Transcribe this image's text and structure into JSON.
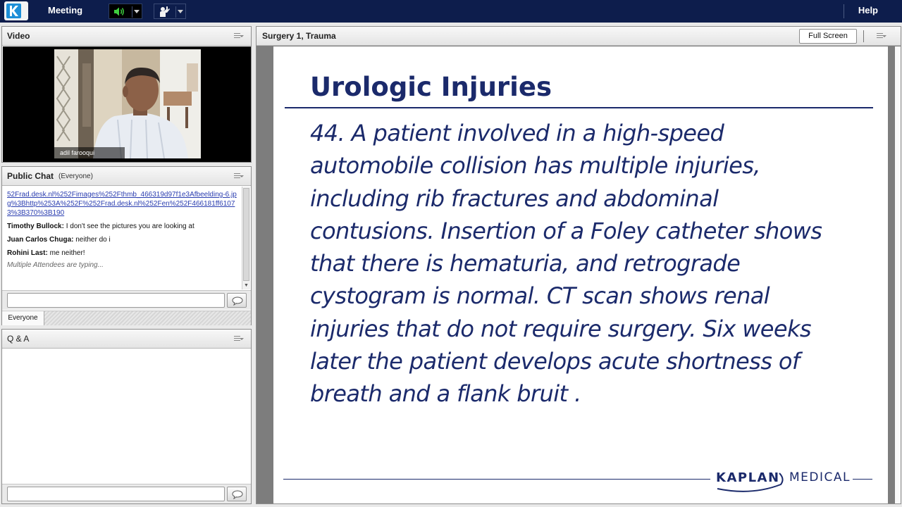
{
  "topbar": {
    "app_logo": "kaplan-k-logo",
    "meeting_label": "Meeting",
    "help_label": "Help",
    "audio_icon": "speaker-icon",
    "hand_icon": "raise-hand-icon"
  },
  "video": {
    "title": "Video",
    "participant_name": "adil farooqui"
  },
  "chat": {
    "title": "Public Chat",
    "scope": "(Everyone)",
    "link_text": "52Frad.desk.nl%252Fimages%252Fthmb_466319d97f1e3Afbeelding-6.jpg%3Bhttp%253A%252F%252Frad.desk.nl%252Fen%252F466181ff61073%3B370%3B190",
    "messages": [
      {
        "sender": "Timothy Bullock:",
        "text": "I don't see the pictures you are looking at"
      },
      {
        "sender": "Juan Carlos Chuga:",
        "text": "neither do i"
      },
      {
        "sender": "Rohini Last:",
        "text": "me neither!"
      }
    ],
    "typing_status": "Multiple Attendees are typing...",
    "input_value": "",
    "tab_everyone": "Everyone"
  },
  "qa": {
    "title": "Q & A",
    "input_value": ""
  },
  "presentation": {
    "title": "Surgery 1, Trauma",
    "fullscreen_label": "Full Screen",
    "slide": {
      "heading": "Urologic Injuries",
      "body_lines": [
        "44. A patient involved in a high-speed",
        "automobile collision has multiple injuries,",
        "including rib fractures and abdominal",
        "contusions. Insertion of a Foley catheter shows",
        "that there is hematuria, and retrograde",
        "cystogram is normal. CT scan shows renal",
        "injuries that do not require surgery. Six weeks",
        "later the patient develops acute shortness of",
        "breath and a flank bruit ."
      ],
      "brand_kaplan": "KAPLAN",
      "brand_medical": "MEDICAL"
    }
  },
  "colors": {
    "topbar": "#0d1d4c",
    "slide_text": "#1b2a6b",
    "logo_accent": "#1d8fd8",
    "link": "#2a3db0"
  }
}
